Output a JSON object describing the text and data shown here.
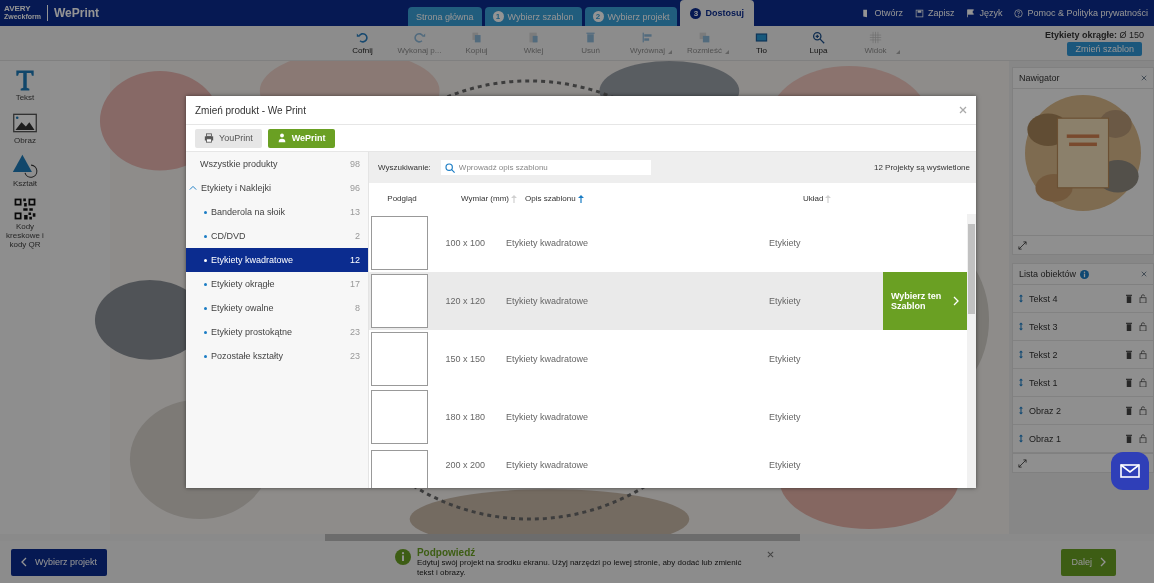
{
  "header": {
    "brand": "AVERY",
    "brand_sub": "Zweckform",
    "product": "WePrint",
    "tabs": [
      {
        "label": "Strona główna",
        "selected": false
      },
      {
        "step": "1",
        "label": "Wybierz szablon",
        "selected": false
      },
      {
        "step": "2",
        "label": "Wybierz projekt",
        "selected": false
      },
      {
        "step": "3",
        "label": "Dostosuj",
        "selected": true
      }
    ],
    "links": [
      "Otwórz",
      "Zapisz",
      "Język",
      "Pomoc & Polityka prywatności"
    ]
  },
  "toolbar": {
    "items": [
      {
        "label": "Cofnij",
        "disabled": false,
        "menu": false
      },
      {
        "label": "Wykonaj p...",
        "disabled": true,
        "menu": false
      },
      {
        "label": "Kopiuj",
        "disabled": true,
        "menu": false
      },
      {
        "label": "Wklej",
        "disabled": true,
        "menu": false
      },
      {
        "label": "Usuń",
        "disabled": true,
        "menu": false
      },
      {
        "label": "Wyrównaj",
        "disabled": true,
        "menu": true
      },
      {
        "label": "Rozmieść",
        "disabled": true,
        "menu": true
      },
      {
        "label": "Tło",
        "disabled": false,
        "menu": false
      },
      {
        "label": "Lupa",
        "disabled": false,
        "menu": false
      },
      {
        "label": "Widok",
        "disabled": true,
        "menu": true
      }
    ],
    "product_label": "Etykiety okrągłe:",
    "product_size": "Ø 150",
    "change_button": "Zmień szablon"
  },
  "tools": [
    "Tekst",
    "Obraz",
    "Kształt",
    "Kody kreskowe i kody QR"
  ],
  "navigator": {
    "title": "Nawigator"
  },
  "objects": {
    "title": "Lista obiektów",
    "items": [
      "Tekst 4",
      "Tekst 3",
      "Tekst 2",
      "Tekst 1",
      "Obraz 2",
      "Obraz 1"
    ]
  },
  "footer": {
    "back": "Wybierz projekt",
    "hint_title": "Podpowiedź",
    "hint_text": "Edytuj swój projekt na środku ekranu. Użyj narzędzi po lewej stronie, aby dodać lub zmienić tekst i obrazy.",
    "next": "Dalej"
  },
  "modal": {
    "title": "Zmień produkt - We Print",
    "sources": [
      {
        "label": "YouPrint",
        "selected": false
      },
      {
        "label": "WePrint",
        "selected": true
      }
    ],
    "categories": [
      {
        "label": "Wszystkie produkty",
        "count": "98",
        "selected": false
      },
      {
        "label": "Etykiety i Naklejki",
        "count": "96",
        "selected": false,
        "expanded": true,
        "children": [
          {
            "label": "Banderola na słoik",
            "count": "13",
            "selected": false
          },
          {
            "label": "CD/DVD",
            "count": "2",
            "selected": false
          },
          {
            "label": "Etykiety kwadratowe",
            "count": "12",
            "selected": true
          },
          {
            "label": "Etykiety okrągłe",
            "count": "17",
            "selected": false
          },
          {
            "label": "Etykiety owalne",
            "count": "8",
            "selected": false
          },
          {
            "label": "Etykiety prostokątne",
            "count": "23",
            "selected": false
          },
          {
            "label": "Pozostałe kształty",
            "count": "23",
            "selected": false
          }
        ]
      }
    ],
    "search_label": "Wyszukiwanie:",
    "search_placeholder": "Wprowadź opis szablonu",
    "result_count": "12 Projekty są wyświetlone",
    "columns": [
      {
        "label": "Podgląd",
        "sortable": false
      },
      {
        "label": "Wymiar (mm)",
        "sortable": true,
        "sorted": false
      },
      {
        "label": "Opis szablonu",
        "sortable": true,
        "sorted": true
      },
      {
        "label": "Układ",
        "sortable": true,
        "sorted": false
      }
    ],
    "rows": [
      {
        "size": "100 x 100",
        "description": "Etykiety kwadratowe",
        "layout": "Etykiety",
        "selected": false
      },
      {
        "size": "120 x 120",
        "description": "Etykiety kwadratowe",
        "layout": "Etykiety",
        "selected": true
      },
      {
        "size": "150 x 150",
        "description": "Etykiety kwadratowe",
        "layout": "Etykiety",
        "selected": false
      },
      {
        "size": "180 x 180",
        "description": "Etykiety kwadratowe",
        "layout": "Etykiety",
        "selected": false
      },
      {
        "size": "200 x 200",
        "description": "Etykiety kwadratowe",
        "layout": "Etykiety",
        "selected": false
      }
    ],
    "choose_button": "Wybierz ten Szablon"
  }
}
